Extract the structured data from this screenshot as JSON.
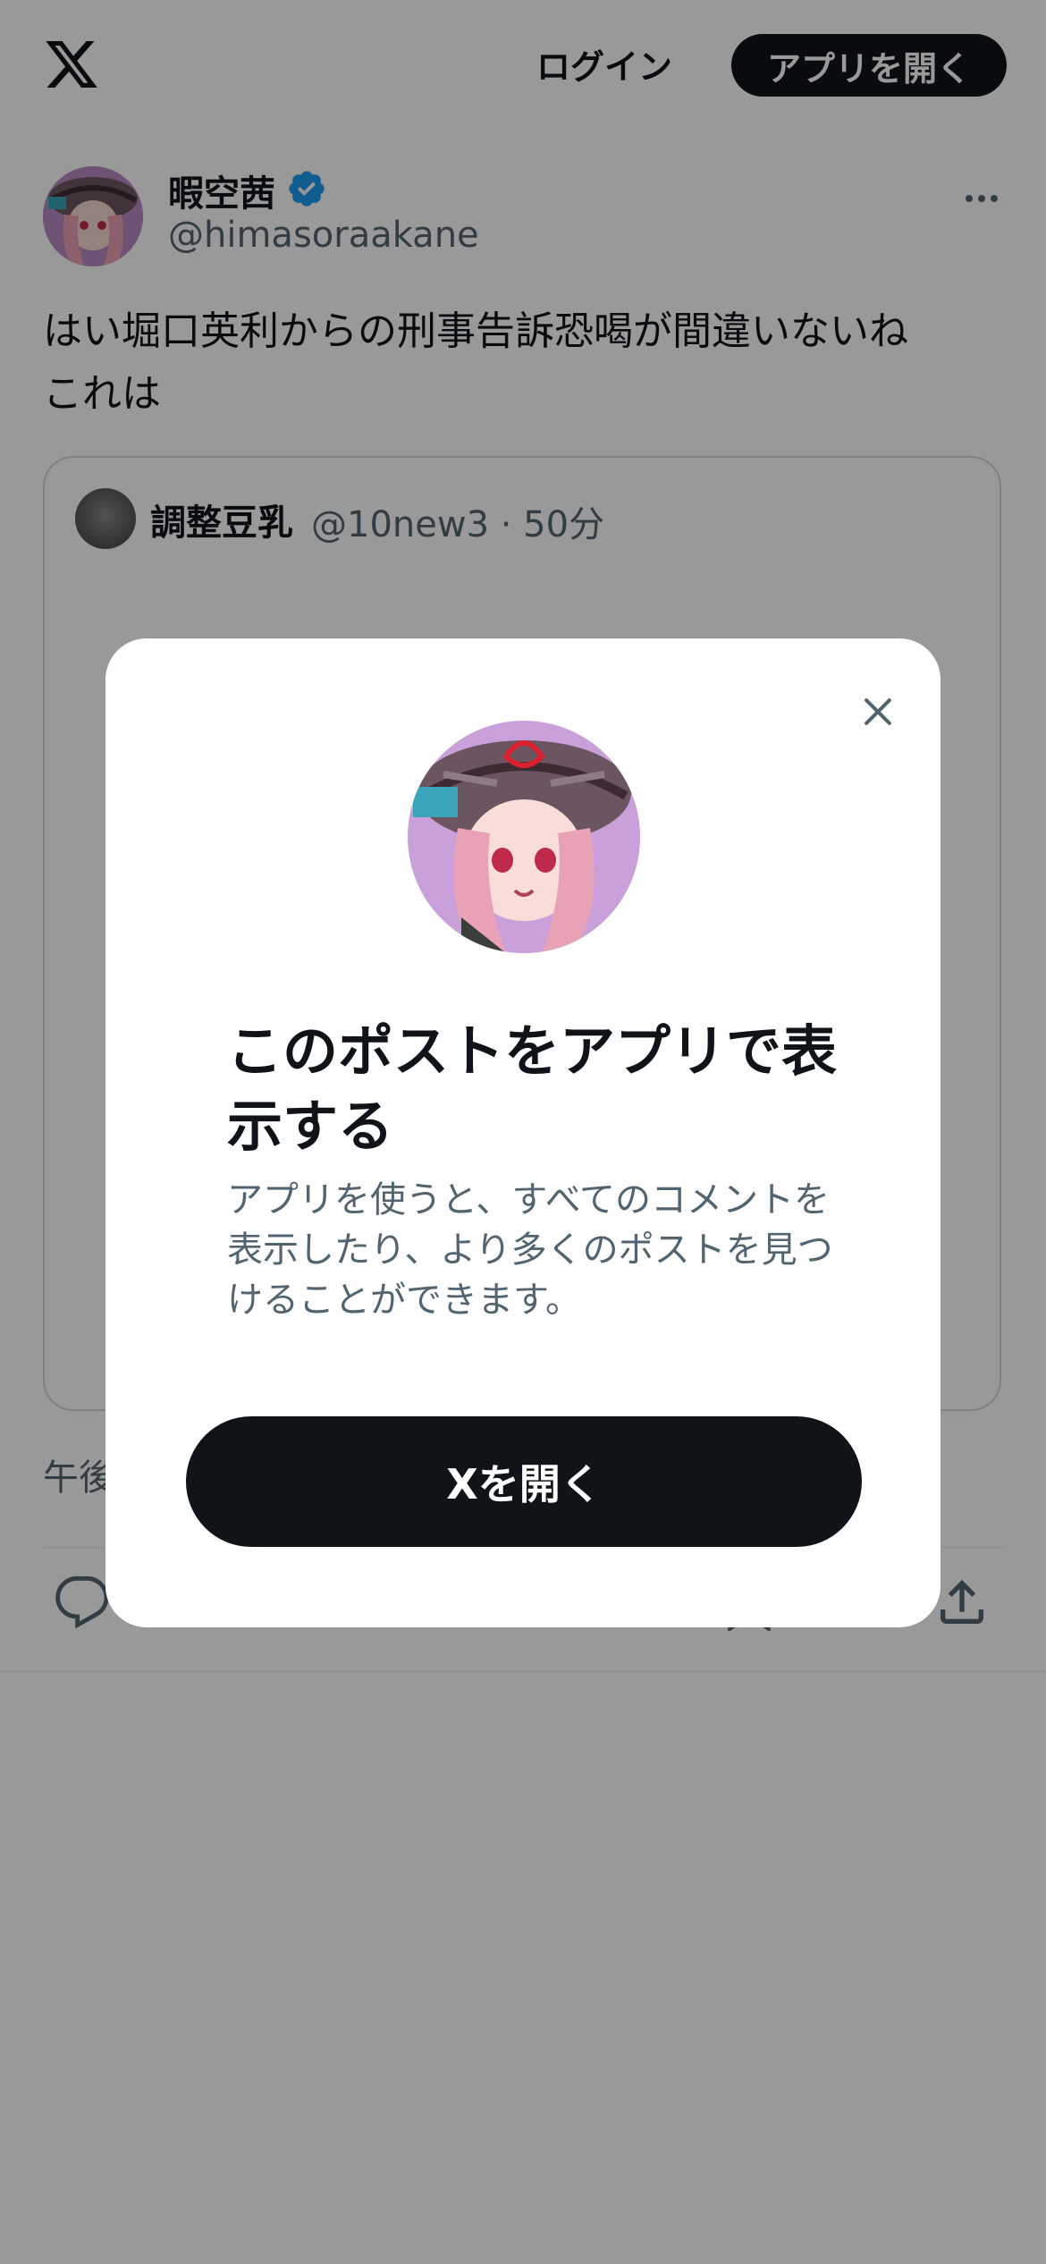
{
  "header": {
    "logo_icon": "x-logo-icon",
    "login_label": "ログイン",
    "open_app_label": "アプリを開く"
  },
  "post": {
    "author_name": "暇空茜",
    "author_handle": "@himasoraakane",
    "verified": true,
    "text_line1": "はい堀口英利からの刑事告訴恐喝が間違いないね",
    "text_line2": "これは",
    "quote": {
      "name": "調整豆乳",
      "meta": "@10new3 · 50分"
    },
    "time_partial": "午後",
    "actions": [
      "reply-icon",
      "repost-icon",
      "like-icon",
      "bookmark-icon",
      "share-icon"
    ]
  },
  "modal": {
    "title": "このポストをアプリで表示する",
    "description": "アプリを使うと、すべてのコメントを表示したり、より多くのポストを見つけることができます。",
    "button_label": "Xを開く",
    "close_icon": "close-icon"
  },
  "colors": {
    "primary_text": "#0f1419",
    "secondary_text": "#536471",
    "verified_blue": "#1d9bf0",
    "overlay": "rgba(0,0,0,0.4)"
  }
}
